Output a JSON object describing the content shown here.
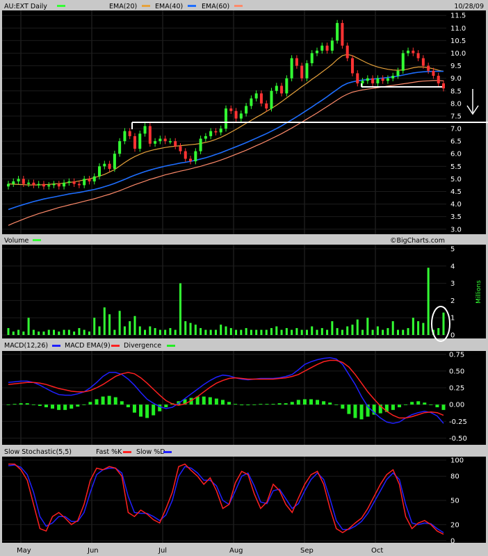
{
  "header": {
    "symbol_label": "AU:EXT Daily",
    "date": "10/28/09",
    "ema20_label": "EMA(20)",
    "ema40_label": "EMA(40)",
    "ema60_label": "EMA(60)"
  },
  "colors": {
    "up": "#33ff33",
    "down": "#ff3333",
    "ema20": "#e6a23c",
    "ema40": "#1e6eff",
    "ema60": "#ff8a6a",
    "macd": "#2020ff",
    "signal": "#ff2020",
    "divergence": "#22ee22",
    "annotation": "#ffffff"
  },
  "watermark": "©BigCharts.com",
  "volume_panel": {
    "title": "Volume",
    "unit_label": "Millions",
    "ticks": [
      "5",
      "4",
      "3",
      "2",
      "1",
      "0"
    ]
  },
  "macd_panel": {
    "title_macd": "MACD(12,26)",
    "title_ema": "MACD EMA(9)",
    "title_div": "Divergence",
    "ticks": [
      "0.75",
      "0.50",
      "0.25",
      "0.00",
      "-0.25",
      "-0.50"
    ]
  },
  "stoch_panel": {
    "title": "Slow Stochastic(5,5)",
    "fast_label": "Fast %K",
    "slow_label": "Slow %D",
    "ticks": [
      "100",
      "80",
      "50",
      "20",
      "0"
    ]
  },
  "x_labels": [
    "May",
    "Jun",
    "Jul",
    "Aug",
    "Sep",
    "Oct"
  ],
  "chart_data": [
    {
      "type": "candlestick",
      "title": "AU:EXT Daily",
      "ylim": [
        2.8,
        11.7
      ],
      "y_ticks": [
        3.0,
        3.5,
        4.0,
        4.5,
        5.0,
        5.5,
        6.0,
        6.5,
        7.0,
        7.5,
        8.0,
        8.5,
        9.0,
        9.5,
        10.0,
        10.5,
        11.0,
        11.5
      ],
      "close": [
        4.8,
        4.9,
        5.0,
        4.8,
        4.85,
        4.75,
        4.8,
        4.7,
        4.75,
        4.8,
        4.7,
        4.85,
        4.9,
        4.8,
        4.75,
        5.0,
        4.9,
        5.1,
        5.5,
        5.6,
        5.4,
        6.0,
        6.5,
        6.9,
        6.7,
        6.2,
        6.8,
        7.1,
        6.4,
        6.5,
        6.6,
        6.5,
        6.5,
        6.3,
        6.1,
        5.8,
        5.7,
        6.1,
        6.6,
        6.7,
        6.9,
        6.85,
        7.0,
        7.8,
        7.7,
        7.4,
        7.6,
        7.9,
        8.2,
        8.4,
        8.0,
        7.8,
        8.5,
        8.7,
        8.4,
        9.0,
        9.8,
        9.5,
        9.0,
        9.6,
        10.0,
        10.1,
        10.3,
        10.1,
        10.5,
        11.2,
        10.3,
        9.8,
        9.2,
        8.8,
        8.9,
        9.0,
        8.8,
        9.0,
        8.9,
        9.0,
        9.1,
        9.3,
        10.0,
        10.1,
        10.0,
        9.8,
        9.5,
        9.3,
        9.1,
        8.8,
        8.6
      ],
      "ema20": [
        4.8,
        4.79,
        4.78,
        4.77,
        4.76,
        4.76,
        4.76,
        4.77,
        4.78,
        4.8,
        4.81,
        4.83,
        4.86,
        4.88,
        4.92,
        4.96,
        5.0,
        5.05,
        5.11,
        5.18,
        5.27,
        5.37,
        5.51,
        5.65,
        5.78,
        5.89,
        5.98,
        6.06,
        6.12,
        6.17,
        6.21,
        6.25,
        6.28,
        6.3,
        6.32,
        6.34,
        6.36,
        6.38,
        6.41,
        6.45,
        6.5,
        6.57,
        6.65,
        6.75,
        6.86,
        6.97,
        7.09,
        7.21,
        7.33,
        7.45,
        7.56,
        7.68,
        7.8,
        7.93,
        8.07,
        8.22,
        8.37,
        8.52,
        8.67,
        8.81,
        8.96,
        9.1,
        9.25,
        9.4,
        9.56,
        9.75,
        9.9,
        9.95,
        9.9,
        9.8,
        9.7,
        9.6,
        9.52,
        9.45,
        9.4,
        9.36,
        9.33,
        9.32,
        9.33,
        9.37,
        9.42,
        9.45,
        9.45,
        9.42,
        9.38,
        9.32,
        9.28
      ],
      "ema40": [
        3.78,
        3.85,
        3.92,
        3.98,
        4.04,
        4.1,
        4.15,
        4.2,
        4.24,
        4.28,
        4.32,
        4.36,
        4.4,
        4.43,
        4.46,
        4.5,
        4.54,
        4.58,
        4.63,
        4.69,
        4.75,
        4.82,
        4.9,
        4.98,
        5.07,
        5.15,
        5.22,
        5.29,
        5.35,
        5.41,
        5.46,
        5.51,
        5.55,
        5.59,
        5.63,
        5.66,
        5.7,
        5.74,
        5.79,
        5.84,
        5.9,
        5.97,
        6.04,
        6.12,
        6.2,
        6.28,
        6.36,
        6.44,
        6.53,
        6.62,
        6.71,
        6.8,
        6.9,
        7.0,
        7.11,
        7.23,
        7.35,
        7.47,
        7.6,
        7.73,
        7.86,
        8.0,
        8.13,
        8.27,
        8.42,
        8.56,
        8.7,
        8.8,
        8.86,
        8.9,
        8.93,
        8.95,
        8.97,
        8.99,
        9.01,
        9.03,
        9.06,
        9.09,
        9.13,
        9.17,
        9.21,
        9.24,
        9.26,
        9.27,
        9.28,
        9.28,
        9.28
      ],
      "ema60": [
        3.15,
        3.24,
        3.32,
        3.4,
        3.48,
        3.55,
        3.62,
        3.68,
        3.74,
        3.8,
        3.86,
        3.91,
        3.96,
        4.01,
        4.06,
        4.11,
        4.16,
        4.21,
        4.27,
        4.33,
        4.39,
        4.46,
        4.53,
        4.61,
        4.69,
        4.77,
        4.84,
        4.91,
        4.98,
        5.04,
        5.1,
        5.16,
        5.21,
        5.26,
        5.31,
        5.35,
        5.4,
        5.45,
        5.5,
        5.56,
        5.62,
        5.68,
        5.75,
        5.82,
        5.9,
        5.98,
        6.06,
        6.14,
        6.23,
        6.32,
        6.41,
        6.5,
        6.6,
        6.7,
        6.8,
        6.91,
        7.02,
        7.14,
        7.26,
        7.38,
        7.5,
        7.62,
        7.75,
        7.88,
        8.01,
        8.14,
        8.27,
        8.37,
        8.45,
        8.5,
        8.54,
        8.57,
        8.6,
        8.63,
        8.66,
        8.69,
        8.72,
        8.75,
        8.78,
        8.81,
        8.84,
        8.87,
        8.89,
        8.9,
        8.91,
        8.91,
        8.9
      ]
    },
    {
      "type": "bar",
      "title": "Volume",
      "ylabel": "Millions",
      "ylim": [
        0,
        5
      ],
      "values": [
        0.4,
        0.2,
        0.3,
        0.2,
        1.0,
        0.3,
        0.2,
        0.2,
        0.3,
        0.3,
        0.2,
        0.3,
        0.3,
        0.2,
        0.4,
        0.3,
        0.2,
        1.0,
        0.5,
        1.6,
        1.2,
        0.3,
        1.4,
        0.5,
        0.8,
        1.1,
        0.5,
        0.3,
        0.5,
        0.4,
        0.3,
        0.3,
        0.4,
        0.3,
        3.0,
        0.8,
        0.7,
        0.6,
        0.4,
        0.3,
        0.3,
        0.3,
        0.6,
        0.5,
        0.4,
        0.3,
        0.3,
        0.4,
        0.3,
        0.3,
        0.3,
        0.3,
        0.4,
        0.5,
        0.3,
        0.4,
        0.3,
        0.4,
        0.3,
        0.3,
        0.5,
        0.3,
        0.4,
        0.3,
        0.8,
        0.4,
        0.3,
        0.5,
        0.6,
        0.9,
        0.3,
        1.0,
        0.3,
        0.5,
        0.3,
        0.4,
        0.8,
        0.3,
        0.3,
        0.4,
        1.0,
        0.8,
        0.7,
        3.9,
        0.3,
        0.4,
        1.3
      ]
    },
    {
      "type": "line",
      "title": "MACD(12,26)",
      "ylim": [
        -0.6,
        0.8
      ],
      "series": [
        {
          "name": "MACD(12,26)",
          "values": [
            0.33,
            0.34,
            0.35,
            0.35,
            0.33,
            0.29,
            0.24,
            0.19,
            0.15,
            0.14,
            0.14,
            0.16,
            0.19,
            0.25,
            0.33,
            0.42,
            0.48,
            0.48,
            0.45,
            0.38,
            0.29,
            0.18,
            0.08,
            0.02,
            -0.03,
            -0.06,
            -0.04,
            0.02,
            0.09,
            0.16,
            0.23,
            0.3,
            0.36,
            0.41,
            0.44,
            0.43,
            0.4,
            0.38,
            0.37,
            0.38,
            0.39,
            0.39,
            0.39,
            0.4,
            0.42,
            0.45,
            0.52,
            0.6,
            0.64,
            0.67,
            0.69,
            0.7,
            0.68,
            0.6,
            0.45,
            0.3,
            0.12,
            -0.03,
            -0.12,
            -0.2,
            -0.26,
            -0.28,
            -0.26,
            -0.2,
            -0.15,
            -0.12,
            -0.1,
            -0.12,
            -0.17,
            -0.28
          ]
        },
        {
          "name": "MACD EMA(9)",
          "values": [
            0.3,
            0.31,
            0.32,
            0.33,
            0.33,
            0.32,
            0.3,
            0.27,
            0.24,
            0.22,
            0.2,
            0.19,
            0.19,
            0.21,
            0.25,
            0.3,
            0.36,
            0.42,
            0.46,
            0.48,
            0.46,
            0.4,
            0.32,
            0.23,
            0.14,
            0.06,
            0.01,
            -0.01,
            0.01,
            0.06,
            0.12,
            0.19,
            0.26,
            0.32,
            0.36,
            0.39,
            0.4,
            0.39,
            0.38,
            0.38,
            0.38,
            0.38,
            0.38,
            0.39,
            0.4,
            0.42,
            0.45,
            0.5,
            0.55,
            0.6,
            0.64,
            0.66,
            0.66,
            0.63,
            0.56,
            0.45,
            0.32,
            0.19,
            0.08,
            -0.02,
            -0.1,
            -0.16,
            -0.2,
            -0.2,
            -0.18,
            -0.15,
            -0.12,
            -0.11,
            -0.12,
            -0.16
          ]
        }
      ],
      "divergence": [
        0.0,
        0.01,
        0.02,
        0.02,
        0.0,
        -0.02,
        -0.04,
        -0.06,
        -0.08,
        -0.08,
        -0.06,
        -0.03,
        0.0,
        0.04,
        0.08,
        0.12,
        0.13,
        0.11,
        0.05,
        -0.04,
        -0.12,
        -0.18,
        -0.2,
        -0.16,
        -0.1,
        -0.04,
        0.02,
        0.05,
        0.08,
        0.1,
        0.12,
        0.12,
        0.11,
        0.09,
        0.07,
        0.04,
        0.01,
        -0.01,
        -0.01,
        0.0,
        0.01,
        0.01,
        0.01,
        0.02,
        0.02,
        0.04,
        0.07,
        0.08,
        0.08,
        0.07,
        0.05,
        0.03,
        0.0,
        -0.06,
        -0.14,
        -0.2,
        -0.22,
        -0.18,
        -0.15,
        -0.13,
        -0.11,
        -0.08,
        -0.04,
        0.0,
        0.04,
        0.05,
        0.03,
        0.0,
        -0.04,
        -0.08
      ]
    },
    {
      "type": "line",
      "title": "Slow Stochastic(5,5)",
      "ylim": [
        0,
        100
      ],
      "series": [
        {
          "name": "Fast %K",
          "values": [
            95,
            95,
            88,
            75,
            45,
            15,
            12,
            30,
            35,
            28,
            20,
            25,
            45,
            75,
            90,
            88,
            92,
            90,
            80,
            35,
            30,
            38,
            33,
            26,
            22,
            40,
            60,
            92,
            95,
            87,
            80,
            70,
            78,
            62,
            40,
            45,
            72,
            86,
            82,
            58,
            40,
            48,
            70,
            62,
            45,
            35,
            53,
            70,
            82,
            86,
            70,
            40,
            15,
            10,
            15,
            22,
            28,
            40,
            55,
            70,
            82,
            88,
            70,
            30,
            15,
            22,
            25,
            20,
            12,
            8
          ]
        },
        {
          "name": "Slow %D",
          "values": [
            93,
            94,
            91,
            82,
            60,
            30,
            18,
            22,
            30,
            30,
            24,
            24,
            35,
            60,
            82,
            88,
            90,
            90,
            84,
            55,
            35,
            34,
            34,
            30,
            25,
            32,
            50,
            80,
            92,
            90,
            84,
            75,
            75,
            68,
            50,
            45,
            62,
            80,
            84,
            68,
            48,
            46,
            62,
            64,
            52,
            40,
            46,
            62,
            76,
            84,
            76,
            52,
            25,
            14,
            14,
            18,
            24,
            34,
            48,
            62,
            76,
            84,
            76,
            45,
            22,
            20,
            22,
            21,
            15,
            10
          ]
        }
      ]
    }
  ]
}
